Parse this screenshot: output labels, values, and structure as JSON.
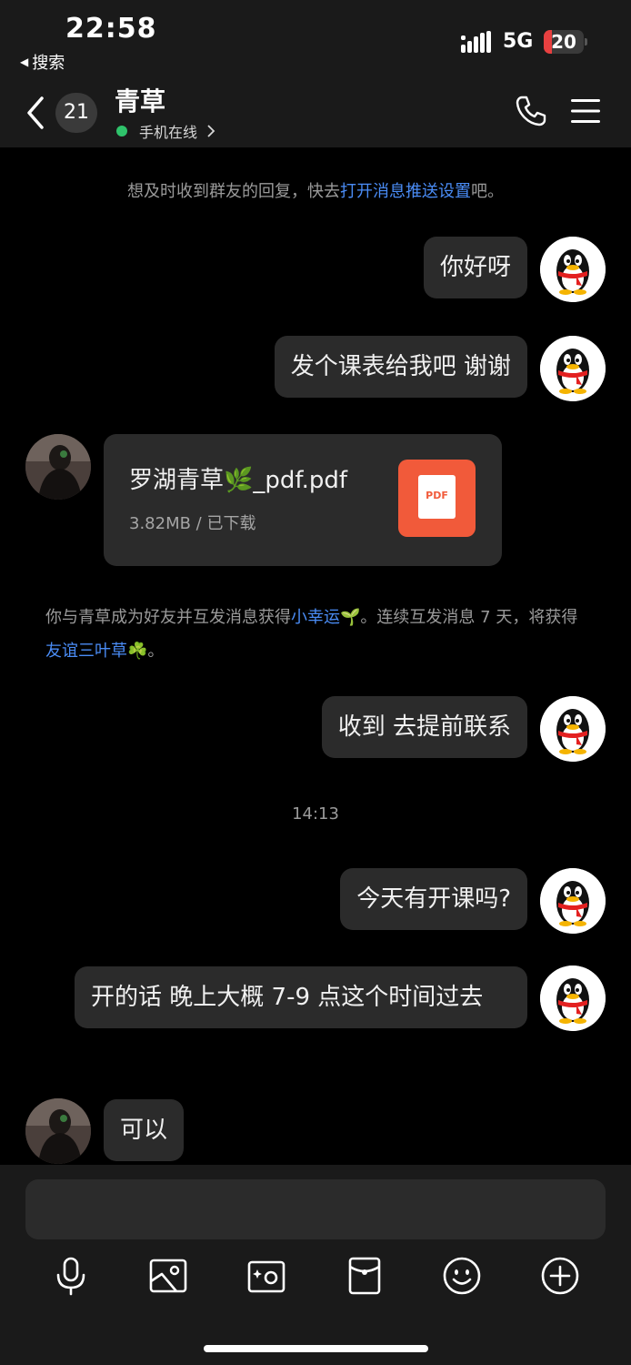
{
  "status_bar": {
    "time": "22:58",
    "back_app_label": "搜索",
    "network": "5G",
    "battery_level": "20"
  },
  "nav": {
    "unread_count": "21",
    "contact_name": "青草",
    "online_status": "手机在线"
  },
  "notice": {
    "prefix": "想及时收到群友的回复，快去",
    "link": "打开消息推送设置",
    "suffix": "吧。"
  },
  "messages": [
    {
      "sender": "me",
      "text": "你好呀"
    },
    {
      "sender": "me",
      "text": "发个课表给我吧 谢谢"
    },
    {
      "sender": "friend",
      "type": "file",
      "file_name": "罗湖青草🌿_pdf.pdf",
      "file_meta": "3.82MB / 已下载",
      "file_type": "PDF"
    },
    {
      "sender": "me",
      "text": "收到 去提前联系"
    },
    {
      "sender": "me",
      "text": "今天有开课吗?"
    },
    {
      "sender": "me",
      "text": "开的话 晚上大概 7-9 点这个时间过去"
    },
    {
      "sender": "friend",
      "text": "可以"
    }
  ],
  "system_message": {
    "part1": "你与青草成为好友并互发消息获得",
    "link1": "小幸运🌱",
    "part2": "。连续互发消息 7 天，将获得",
    "link2": "友谊三叶草☘️",
    "part3": "。"
  },
  "timestamp": "14:13",
  "input": {
    "value": "",
    "placeholder": ""
  },
  "toolbar_icons": [
    "microphone-icon",
    "image-icon",
    "camera-icon",
    "red-packet-icon",
    "emoji-icon",
    "plus-icon"
  ],
  "colors": {
    "background": "#000000",
    "bar": "#1a1a1a",
    "bubble": "#2b2b2b",
    "link": "#4a8cf5",
    "online": "#2fc36b",
    "pdf": "#f15a3a",
    "battery_low": "#e84040"
  }
}
